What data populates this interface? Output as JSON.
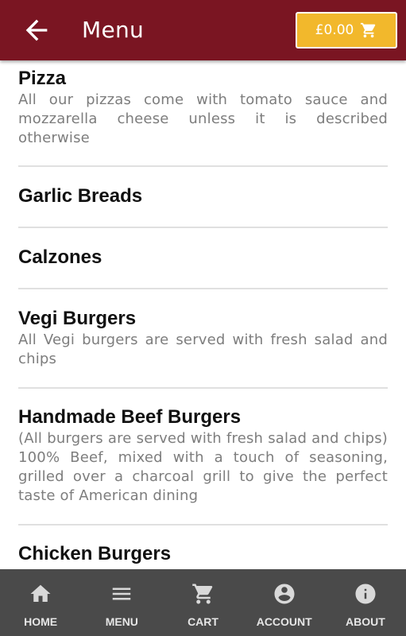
{
  "header": {
    "title": "Menu",
    "back_icon": "arrow-left-icon",
    "cart_total": "£0.00",
    "cart_icon": "shopping-cart-icon"
  },
  "categories": [
    {
      "name": "Pizza",
      "description": "All our pizzas come with tomato sauce and mozzarella cheese unless it is described otherwise"
    },
    {
      "name": "Garlic Breads",
      "description": ""
    },
    {
      "name": "Calzones",
      "description": ""
    },
    {
      "name": "Vegi Burgers",
      "description": "All Vegi burgers are served with fresh salad and chips"
    },
    {
      "name": "Handmade Beef Burgers",
      "description": "(All burgers are served with fresh salad and chips) 100% Beef, mixed with a touch of seasoning, grilled over a charcoal grill to give the perfect taste of American dining"
    },
    {
      "name": "Chicken Burgers",
      "description": ""
    }
  ],
  "nav": [
    {
      "label": "HOME",
      "icon": "home-icon"
    },
    {
      "label": "MENU",
      "icon": "hamburger-menu-icon"
    },
    {
      "label": "CART",
      "icon": "shopping-cart-icon"
    },
    {
      "label": "ACCOUNT",
      "icon": "account-circle-icon"
    },
    {
      "label": "ABOUT",
      "icon": "info-icon"
    }
  ],
  "colors": {
    "header_bg": "#7a1522",
    "cart_button_bg": "#f2b82c",
    "nav_bg": "#4a4a4a"
  }
}
